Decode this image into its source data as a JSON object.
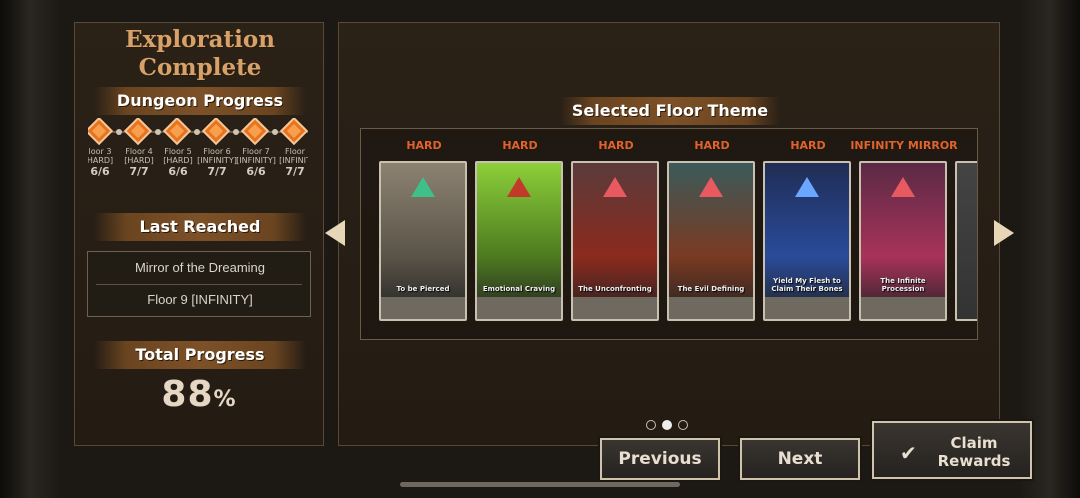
{
  "left": {
    "title_line1": "Exploration",
    "title_line2": "Complete",
    "dungeon_progress_label": "Dungeon Progress",
    "floors": [
      {
        "label_line1": "loor 3",
        "label_line2": "HARD]",
        "score": "6/6"
      },
      {
        "label_line1": "Floor 4",
        "label_line2": "[HARD]",
        "score": "7/7"
      },
      {
        "label_line1": "Floor 5",
        "label_line2": "[HARD]",
        "score": "6/6"
      },
      {
        "label_line1": "Floor 6",
        "label_line2": "[INFINITY]",
        "score": "7/7"
      },
      {
        "label_line1": "Floor 7",
        "label_line2": "[INFINITY]",
        "score": "6/6"
      },
      {
        "label_line1": "Floor",
        "label_line2": "[INFINIT",
        "score": "7/7"
      }
    ],
    "last_reached_label": "Last Reached",
    "last_reached_name": "Mirror of the Dreaming",
    "last_reached_floor": "Floor 9 [INFINITY]",
    "total_progress_label": "Total Progress",
    "total_progress_value": "88",
    "total_progress_symbol": "%"
  },
  "right": {
    "section_title": "Selected Floor Theme",
    "cards": [
      {
        "difficulty": "HARD",
        "caption": "To be Pierced",
        "color_top": "#8c8272",
        "color_mid": "#5a5448",
        "accent": "#3fbf8a"
      },
      {
        "difficulty": "HARD",
        "caption": "Emotional Craving",
        "color_top": "#8ccf3a",
        "color_mid": "#4d7a20",
        "accent": "#c23a2a"
      },
      {
        "difficulty": "HARD",
        "caption": "The Unconfronting",
        "color_top": "#5a3b3b",
        "color_mid": "#8c2a1e",
        "accent": "#e85a60"
      },
      {
        "difficulty": "HARD",
        "caption": "The Evil Defining",
        "color_top": "#3b5a5a",
        "color_mid": "#7a3a22",
        "accent": "#e85a60"
      },
      {
        "difficulty": "HARD",
        "caption": "Yield My Flesh to Claim Their Bones",
        "color_top": "#1f2d55",
        "color_mid": "#2a4b9a",
        "accent": "#6aa8ff"
      },
      {
        "difficulty": "INFINITY MIRROR",
        "caption": "The Infinite Procession",
        "color_top": "#5a2a44",
        "color_mid": "#a8335a",
        "accent": "#e85a60"
      }
    ],
    "page_indicator": {
      "total": 3,
      "active": 1
    }
  },
  "buttons": {
    "previous": "Previous",
    "next": "Next",
    "claim_line1": "Claim",
    "claim_line2": "Rewards"
  },
  "icons": [
    "arrow-left-icon",
    "arrow-right-icon",
    "checkmark-icon",
    "floor-diamond-icon"
  ]
}
